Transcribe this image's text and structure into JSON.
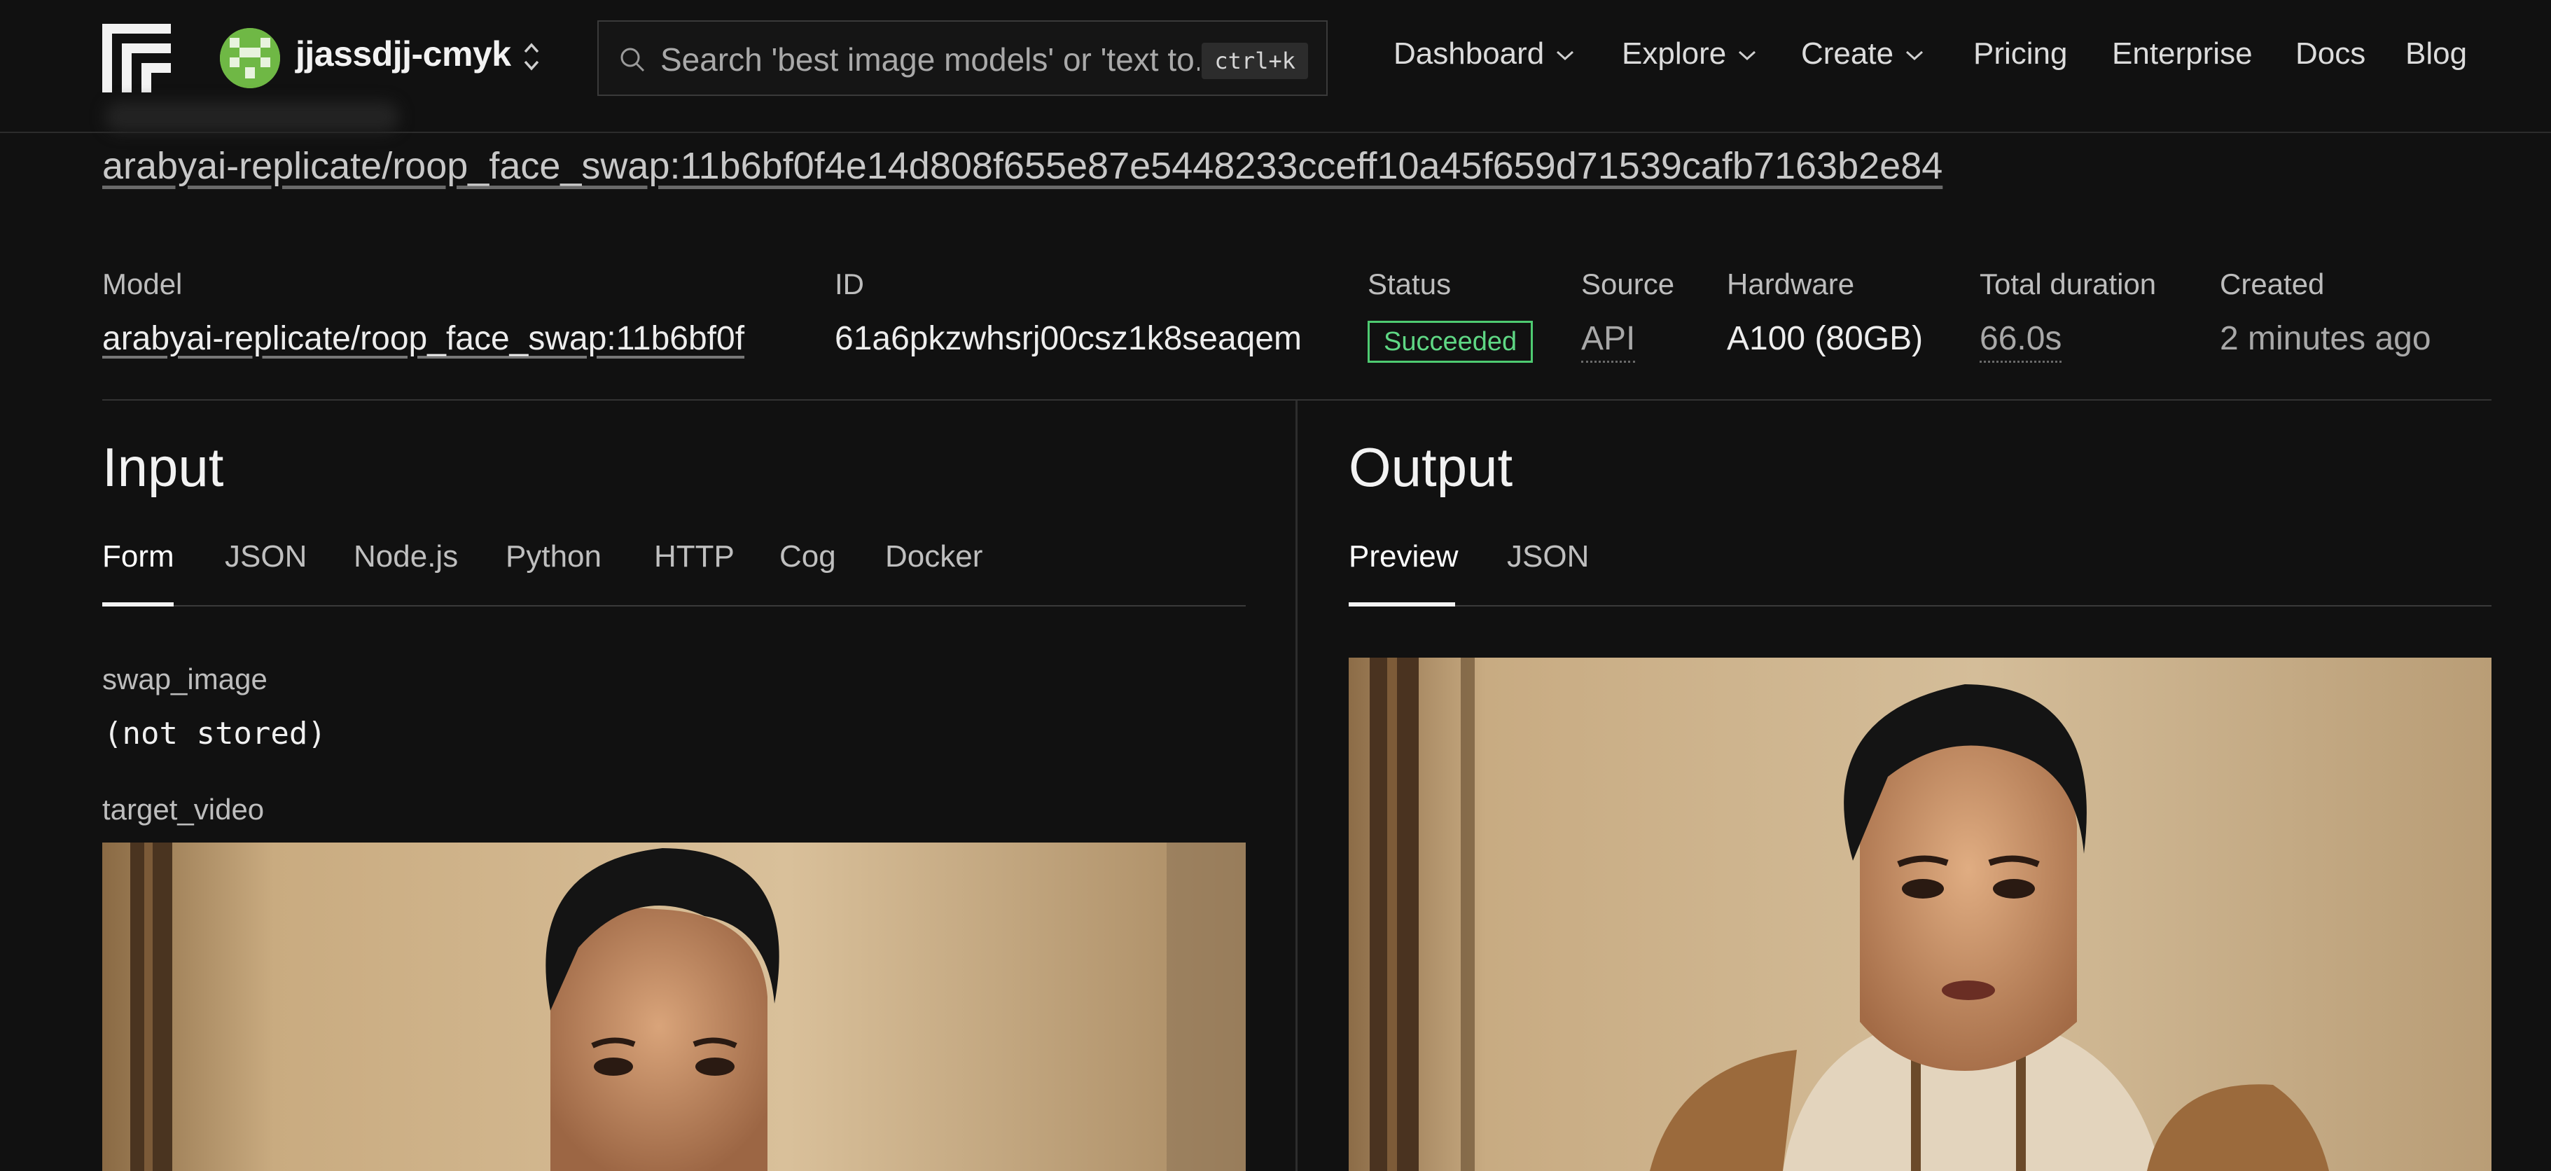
{
  "header": {
    "logo_icon": "replicate-logo-icon",
    "username": "jjassdjj-cmyk",
    "search": {
      "placeholder": "Search 'best image models' or 'text to...",
      "shortcut": "ctrl+k"
    },
    "nav": [
      {
        "label": "Dashboard",
        "has_menu": true
      },
      {
        "label": "Explore",
        "has_menu": true
      },
      {
        "label": "Create",
        "has_menu": true
      },
      {
        "label": "Pricing",
        "has_menu": false
      },
      {
        "label": "Enterprise",
        "has_menu": false
      },
      {
        "label": "Docs",
        "has_menu": false
      },
      {
        "label": "Blog",
        "has_menu": false
      }
    ]
  },
  "page": {
    "title": "arabyai-replicate/roop_face_swap:11b6bf0f4e14d808f655e87e5448233cceff10a45f659d71539cafb7163b2e84"
  },
  "meta": {
    "model": {
      "label": "Model",
      "value": "arabyai-replicate/roop_face_swap:11b6bf0f"
    },
    "id": {
      "label": "ID",
      "value": "61a6pkzwhsrj00csz1k8seaqem"
    },
    "status": {
      "label": "Status",
      "value": "Succeeded",
      "color": "#4ecb71"
    },
    "source": {
      "label": "Source",
      "value": "API"
    },
    "hardware": {
      "label": "Hardware",
      "value": "A100 (80GB)"
    },
    "duration": {
      "label": "Total duration",
      "value": "66.0s"
    },
    "created": {
      "label": "Created",
      "value": "2 minutes ago"
    }
  },
  "input": {
    "heading": "Input",
    "tabs": [
      "Form",
      "JSON",
      "Node.js",
      "Python",
      "HTTP",
      "Cog",
      "Docker"
    ],
    "active_tab": "Form",
    "fields": {
      "swap_image": {
        "label": "swap_image",
        "value": "(not stored)"
      },
      "target_video": {
        "label": "target_video"
      }
    }
  },
  "output": {
    "heading": "Output",
    "tabs": [
      "Preview",
      "JSON"
    ],
    "active_tab": "Preview"
  }
}
